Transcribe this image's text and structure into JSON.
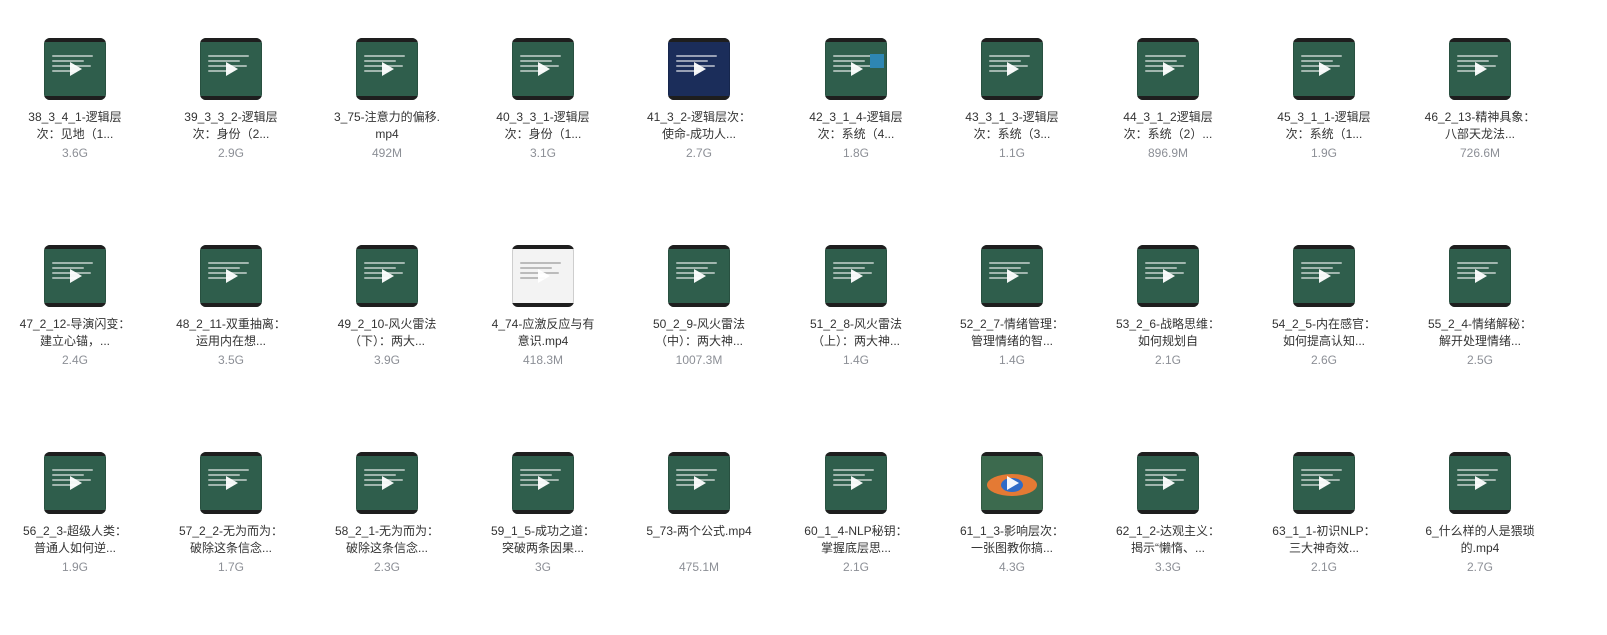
{
  "files": [
    {
      "name": "38_3_4_1-逻辑层次：见地（1...",
      "size": "3.6G",
      "thumb": "green"
    },
    {
      "name": "39_3_3_2-逻辑层次：身份（2...",
      "size": "2.9G",
      "thumb": "green"
    },
    {
      "name": "3_75-注意力的偏移.mp4",
      "size": "492M",
      "thumb": "green"
    },
    {
      "name": "40_3_3_1-逻辑层次：身份（1...",
      "size": "3.1G",
      "thumb": "green"
    },
    {
      "name": "41_3_2-逻辑层次：使命-成功人...",
      "size": "2.7G",
      "thumb": "dark"
    },
    {
      "name": "42_3_1_4-逻辑层次：系统（4...",
      "size": "1.8G",
      "thumb": "teal"
    },
    {
      "name": "43_3_1_3-逻辑层次：系统（3...",
      "size": "1.1G",
      "thumb": "green"
    },
    {
      "name": "44_3_1_2逻辑层次：系统（2）...",
      "size": "896.9M",
      "thumb": "green"
    },
    {
      "name": "45_3_1_1-逻辑层次：系统（1...",
      "size": "1.9G",
      "thumb": "green"
    },
    {
      "name": "46_2_13-精神具象：八部天龙法...",
      "size": "726.6M",
      "thumb": "green"
    },
    {
      "name": "47_2_12-导演闪变：建立心锚，...",
      "size": "2.4G",
      "thumb": "green"
    },
    {
      "name": "48_2_11-双重抽离：运用内在想...",
      "size": "3.5G",
      "thumb": "green"
    },
    {
      "name": "49_2_10-风火雷法（下）：两大...",
      "size": "3.9G",
      "thumb": "green"
    },
    {
      "name": "4_74-应激反应与有意识.mp4",
      "size": "418.3M",
      "thumb": "white"
    },
    {
      "name": "50_2_9-风火雷法（中）：两大神...",
      "size": "1007.3M",
      "thumb": "green"
    },
    {
      "name": "51_2_8-风火雷法（上）：两大神...",
      "size": "1.4G",
      "thumb": "green"
    },
    {
      "name": "52_2_7-情绪管理：管理情绪的智...",
      "size": "1.4G",
      "thumb": "green"
    },
    {
      "name": "53_2_6-战略思维：如何规划自",
      "size": "2.1G",
      "thumb": "green"
    },
    {
      "name": "54_2_5-内在感官：如何提高认知...",
      "size": "2.6G",
      "thumb": "green"
    },
    {
      "name": "55_2_4-情绪解秘：解开处理情绪...",
      "size": "2.5G",
      "thumb": "green"
    },
    {
      "name": "56_2_3-超级人类：普通人如何逆...",
      "size": "1.9G",
      "thumb": "green"
    },
    {
      "name": "57_2_2-无为而为：破除这条信念...",
      "size": "1.7G",
      "thumb": "green"
    },
    {
      "name": "58_2_1-无为而为：破除这条信念...",
      "size": "2.3G",
      "thumb": "green"
    },
    {
      "name": "59_1_5-成功之道：突破两条因果...",
      "size": "3G",
      "thumb": "green"
    },
    {
      "name": "5_73-两个公式.mp4",
      "size": "475.1M",
      "thumb": "green"
    },
    {
      "name": "60_1_4-NLP秘钥：掌握底层思...",
      "size": "2.1G",
      "thumb": "green"
    },
    {
      "name": "61_1_3-影响层次：一张图教你搞...",
      "size": "4.3G",
      "thumb": "orange"
    },
    {
      "name": "62_1_2-达观主义：揭示“懒惰、...",
      "size": "3.3G",
      "thumb": "green"
    },
    {
      "name": "63_1_1-初识NLP：三大神奇效...",
      "size": "2.1G",
      "thumb": "green"
    },
    {
      "name": "6_什么样的人是猥琐的.mp4",
      "size": "2.7G",
      "thumb": "green"
    }
  ]
}
